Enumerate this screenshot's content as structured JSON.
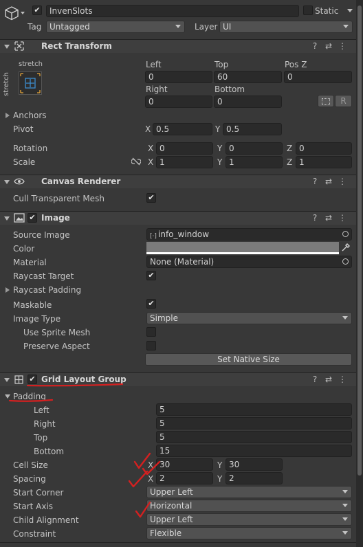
{
  "header": {
    "name": "InvenSlots",
    "active_checked": true,
    "static_label": "Static",
    "tag_label": "Tag",
    "tag_value": "Untagged",
    "layer_label": "Layer",
    "layer_value": "UI"
  },
  "rect_transform": {
    "title": "Rect Transform",
    "anchor_preset_top": "stretch",
    "anchor_preset_side": "stretch",
    "col1_label": "Left",
    "col2_label": "Top",
    "col3_label": "Pos Z",
    "left": "0",
    "top": "60",
    "posz": "0",
    "right_label": "Right",
    "bottom_label": "Bottom",
    "right": "0",
    "bottom": "0",
    "r_button": "R",
    "anchors_label": "Anchors",
    "pivot_label": "Pivot",
    "pivot_x": "0.5",
    "pivot_y": "0.5",
    "rotation_label": "Rotation",
    "rot_x": "0",
    "rot_y": "0",
    "rot_z": "0",
    "scale_label": "Scale",
    "scale_x": "1",
    "scale_y": "1",
    "scale_z": "1",
    "axis_x": "X",
    "axis_y": "Y",
    "axis_z": "Z"
  },
  "canvas_renderer": {
    "title": "Canvas Renderer",
    "cull_label": "Cull Transparent Mesh",
    "cull_checked": true
  },
  "image": {
    "title": "Image",
    "enabled": true,
    "source_label": "Source Image",
    "source_value": "info_window",
    "color_label": "Color",
    "color_value": "#7b7b7b",
    "material_label": "Material",
    "material_value": "None (Material)",
    "raycast_target_label": "Raycast Target",
    "raycast_target_checked": true,
    "raycast_padding_label": "Raycast Padding",
    "maskable_label": "Maskable",
    "maskable_checked": true,
    "image_type_label": "Image Type",
    "image_type_value": "Simple",
    "use_sprite_mesh_label": "Use Sprite Mesh",
    "preserve_aspect_label": "Preserve Aspect",
    "set_native_size": "Set Native Size"
  },
  "grid_layout": {
    "title": "Grid Layout Group",
    "enabled": true,
    "padding_label": "Padding",
    "left_label": "Left",
    "left": "5",
    "right_label": "Right",
    "right": "5",
    "top_label": "Top",
    "top": "5",
    "bottom_label": "Bottom",
    "bottom": "15",
    "cell_size_label": "Cell Size",
    "cell_x": "30",
    "cell_y": "30",
    "spacing_label": "Spacing",
    "spacing_x": "2",
    "spacing_y": "2",
    "start_corner_label": "Start Corner",
    "start_corner": "Upper Left",
    "start_axis_label": "Start Axis",
    "start_axis": "Horizontal",
    "child_alignment_label": "Child Alignment",
    "child_alignment": "Upper Left",
    "constraint_label": "Constraint",
    "constraint": "Flexible"
  },
  "annotation_color": "#d42020"
}
